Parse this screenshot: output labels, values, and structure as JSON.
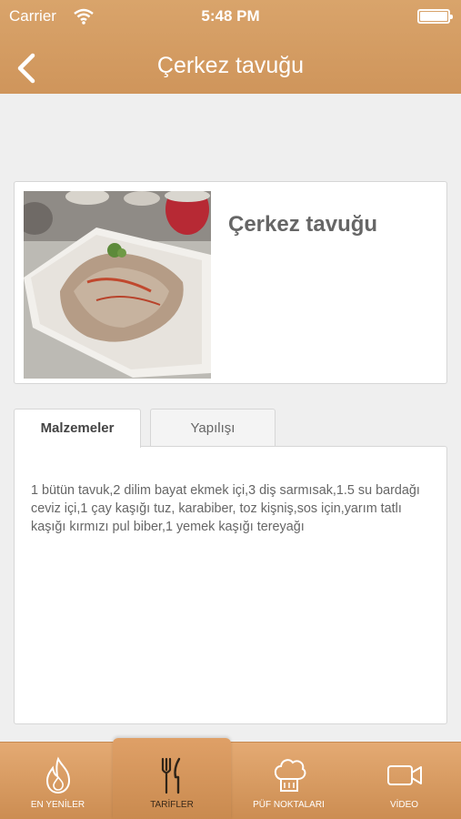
{
  "status_bar": {
    "carrier": "Carrier",
    "time": "5:48 PM"
  },
  "nav": {
    "title": "Çerkez tavuğu",
    "back_icon": "chevron-left-icon"
  },
  "recipe": {
    "name": "Çerkez tavuğu",
    "tabs": [
      {
        "label": "Malzemeler",
        "active": true
      },
      {
        "label": "Yapılışı",
        "active": false
      }
    ],
    "ingredients": "1 bütün tavuk,2 dilim bayat ekmek içi,3 diş sarmısak,1.5 su bardağı ceviz içi,1 çay kaşığı tuz, karabiber, toz kişniş,sos için,yarım tatlı kaşığı kırmızı pul biber,1 yemek kaşığı tereyağı"
  },
  "tabbar": {
    "items": [
      {
        "label": "EN YENİLER",
        "icon": "flame-icon",
        "selected": false
      },
      {
        "label": "TARİFLER",
        "icon": "fork-knife-icon",
        "selected": true
      },
      {
        "label": "PÜF NOKTALARI",
        "icon": "chef-hat-icon",
        "selected": false
      },
      {
        "label": "VİDEO",
        "icon": "video-camera-icon",
        "selected": false
      }
    ]
  },
  "colors": {
    "accent": "#d49c63",
    "background": "#efefef",
    "text": "#666666"
  }
}
